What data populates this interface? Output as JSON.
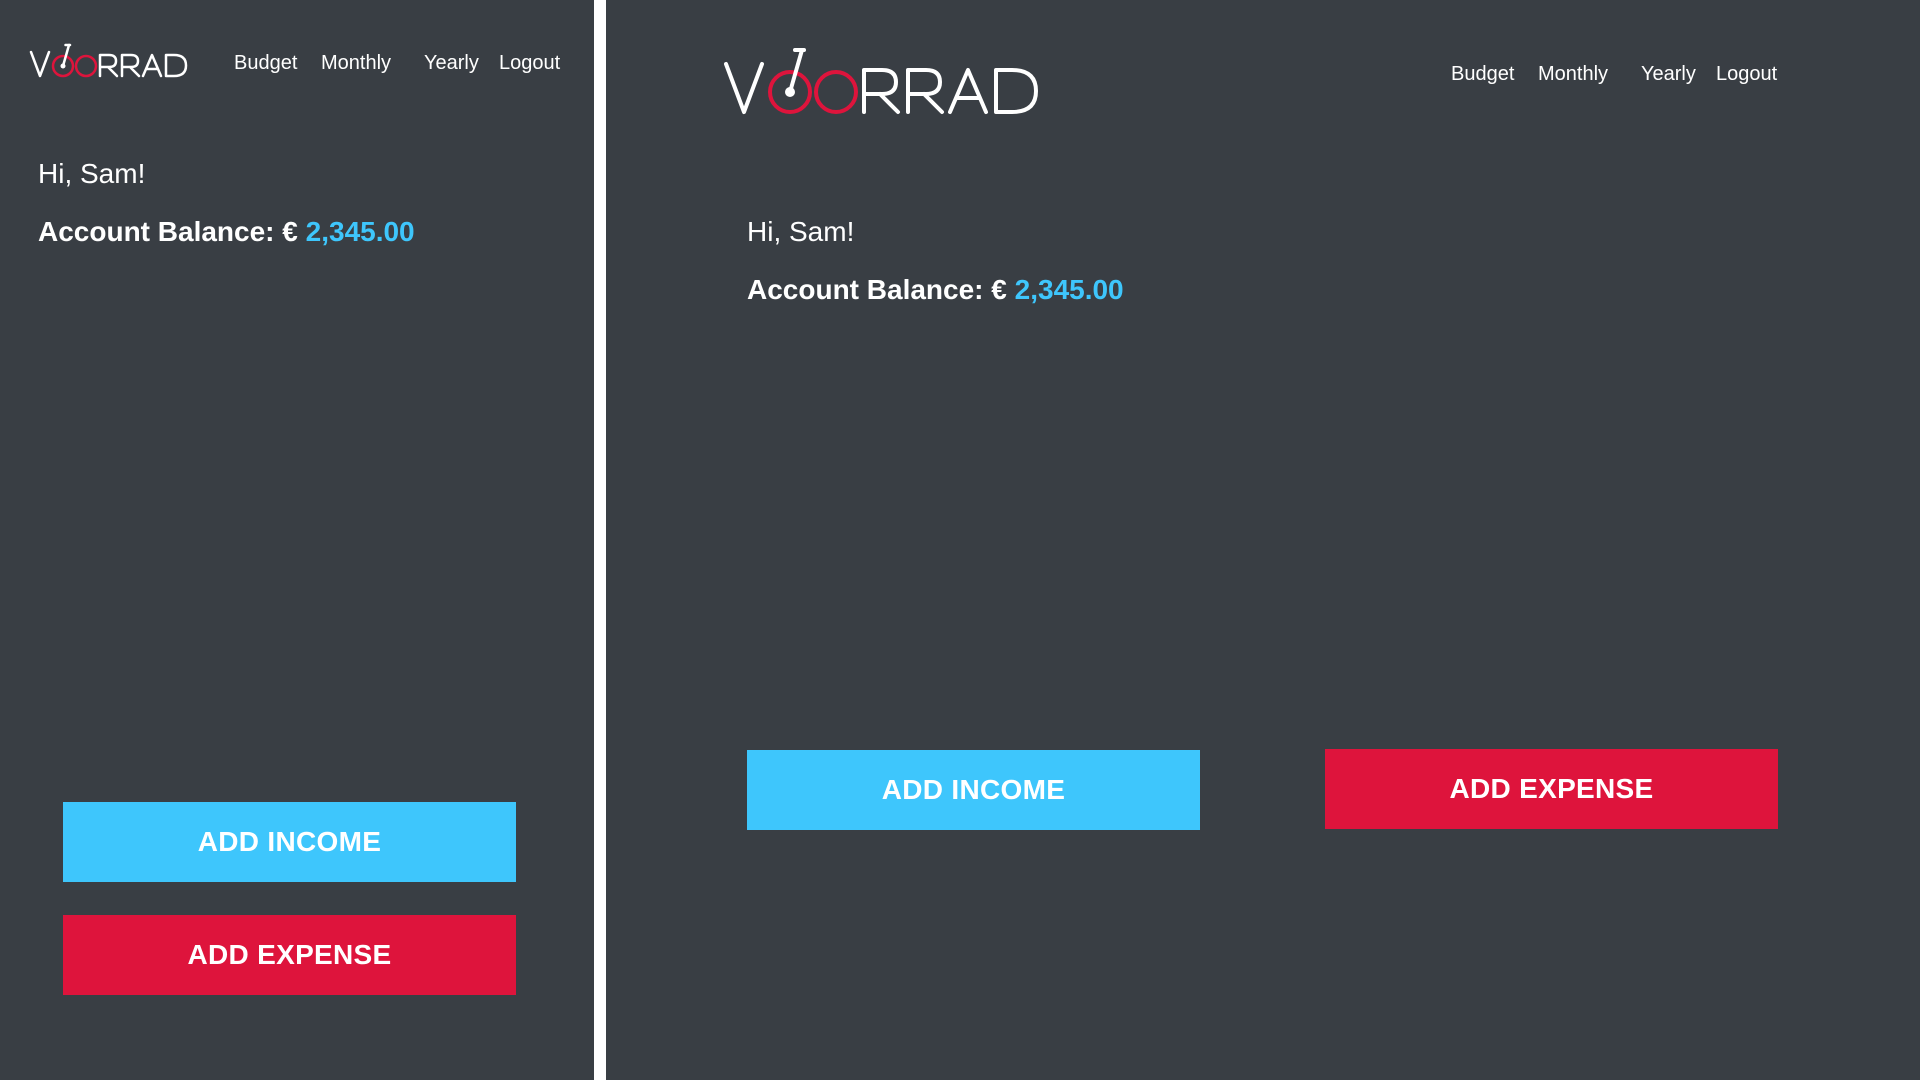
{
  "app": {
    "logo_text": "VOORRAD",
    "colors": {
      "background": "#393e44",
      "income": "#3ec6fc",
      "expense": "#de143c",
      "logo_accent": "#de143c"
    }
  },
  "nav": {
    "budget": "Budget",
    "monthly": "Monthly",
    "yearly": "Yearly",
    "logout": "Logout"
  },
  "dashboard": {
    "greeting": "Hi, Sam!",
    "balance_label": "Account Balance: €",
    "balance_value": "2,345.00"
  },
  "actions": {
    "add_income": "ADD INCOME",
    "add_expense": "ADD EXPENSE"
  }
}
